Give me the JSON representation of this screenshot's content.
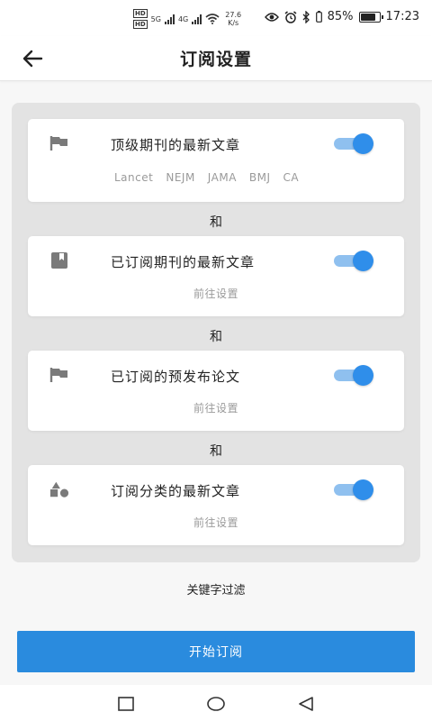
{
  "status_bar": {
    "hd_labels": [
      "HD",
      "HD"
    ],
    "network_1": "5G",
    "network_2": "4G",
    "speed_value": "27.6",
    "speed_unit": "K/s",
    "battery_text": "85%",
    "battery_level": 0.85,
    "time": "17:23"
  },
  "header": {
    "title": "订阅设置"
  },
  "cards": [
    {
      "icon": "flag-icon",
      "title": "顶级期刊的最新文章",
      "enabled": true,
      "journals": [
        "Lancet",
        "NEJM",
        "JAMA",
        "BMJ",
        "CA"
      ]
    },
    {
      "icon": "bookmark-book-icon",
      "title": "已订阅期刊的最新文章",
      "enabled": true,
      "link": "前往设置"
    },
    {
      "icon": "flag-icon",
      "title": "已订阅的预发布论文",
      "enabled": true,
      "link": "前往设置"
    },
    {
      "icon": "shapes-icon",
      "title": "订阅分类的最新文章",
      "enabled": true,
      "link": "前往设置"
    }
  ],
  "connector": "和",
  "keyword_filter": "关键字过滤",
  "start_button": "开始订阅",
  "colors": {
    "accent": "#2a8bde",
    "toggle_knob": "#2f8eea",
    "toggle_track": "#8fc0ef",
    "panel_bg": "#e3e3e3"
  }
}
